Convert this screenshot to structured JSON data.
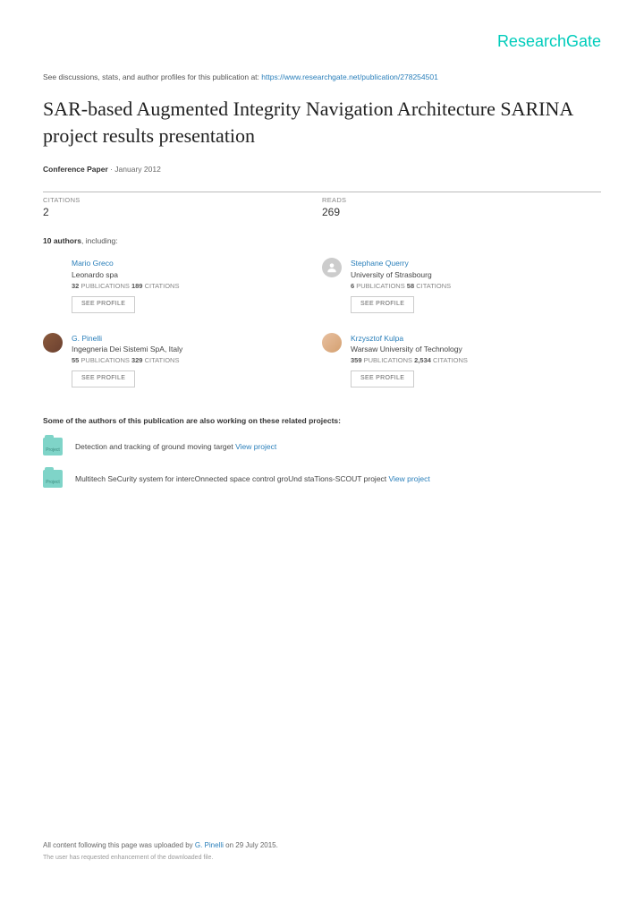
{
  "logo": "ResearchGate",
  "intro_text": "See discussions, stats, and author profiles for this publication at: ",
  "intro_link": "https://www.researchgate.net/publication/278254501",
  "title": "SAR-based Augmented Integrity Navigation Architecture SARINA project results presentation",
  "meta_type": "Conference Paper",
  "meta_date": " · January 2012",
  "citations_label": "CITATIONS",
  "citations": "2",
  "reads_label": "READS",
  "reads": "269",
  "auth_count": "10 authors",
  "auth_suffix": ", including:",
  "authors": [
    {
      "name": "Mario Greco",
      "org": "Leonardo spa",
      "pubs": "32",
      "cits": "189",
      "avatar": "empty"
    },
    {
      "name": "Stephane Querry",
      "org": "University of Strasbourg",
      "pubs": "6",
      "cits": "58",
      "avatar": "ph"
    },
    {
      "name": "G. Pinelli",
      "org": "Ingegneria Dei Sistemi SpA, Italy",
      "pubs": "55",
      "cits": "329",
      "avatar": "photo1"
    },
    {
      "name": "Krzysztof Kulpa",
      "org": "Warsaw University of Technology",
      "pubs": "359",
      "cits": "2,534",
      "avatar": "photo2"
    }
  ],
  "pubs_label": " PUBLICATIONS   ",
  "cits_label": " CITATIONS",
  "see_profile": "SEE PROFILE",
  "proj_head": "Some of the authors of this publication are also working on these related projects:",
  "proj_badge": "Project",
  "projects": [
    {
      "text": "Detection and tracking of ground moving target ",
      "link": "View project"
    },
    {
      "text": "Multitech SeCurity system for intercOnnected space control groUnd staTions-SCOUT project ",
      "link": "View project"
    }
  ],
  "footer_pre": "All content following this page was uploaded by ",
  "footer_author": "G. Pinelli",
  "footer_post": " on 29 July 2015.",
  "footer_note": "The user has requested enhancement of the downloaded file."
}
